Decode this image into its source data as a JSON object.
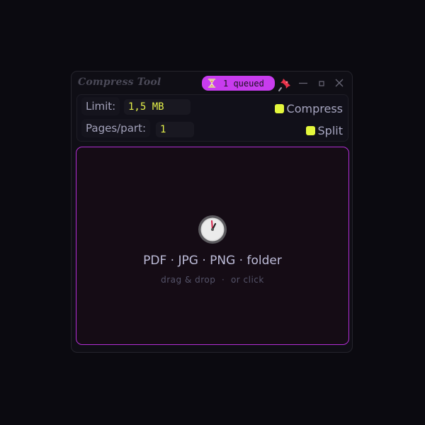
{
  "window": {
    "title": "Compress Tool",
    "queue_badge": {
      "icon": "hourglass-icon",
      "text": "1 queued"
    },
    "controls": [
      "pin-icon",
      "minimize-icon",
      "maximize-icon",
      "close-icon"
    ]
  },
  "settings": {
    "limit": {
      "label": "Limit:",
      "value": "1,5 MB"
    },
    "pages_per_part": {
      "label": "Pages/part:",
      "value": "1"
    },
    "options": {
      "compress": {
        "label": "Compress",
        "checked": true
      },
      "split": {
        "label": "Split",
        "checked": true
      }
    }
  },
  "dropzone": {
    "icon": "timer-icon",
    "formats": "PDF · JPG · PNG · folder",
    "hint": "drag & drop  ·  or click"
  },
  "colors": {
    "accent_magenta": "#c83cee",
    "accent_yellow": "#e4f73c",
    "background": "#0b0a10"
  }
}
